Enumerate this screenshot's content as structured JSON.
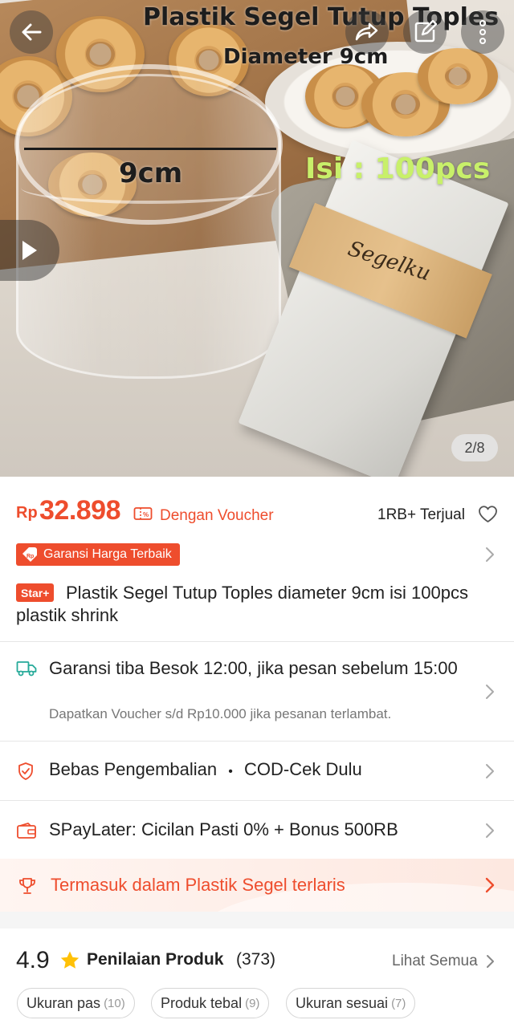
{
  "hero": {
    "caption_title": "Plastik Segel Tutup Toples",
    "caption_diameter": "Diameter 9cm",
    "caption_size": "9cm",
    "caption_isi": "Isi : 100pcs",
    "brand_band": "Segelku",
    "page_indicator": "2/8",
    "icons": [
      "back-arrow-icon",
      "share-icon",
      "edit-icon",
      "more-icon",
      "play-icon"
    ]
  },
  "price": {
    "currency": "Rp",
    "value": "32.898",
    "voucher_label": "Dengan Voucher",
    "sold": "1RB+ Terjual",
    "accent": "#ee4d2d"
  },
  "garansi_badge": "Garansi Harga Terbaik",
  "star_badge": "Star+",
  "product_title": "Plastik Segel Tutup Toples diameter 9cm isi 100pcs plastik shrink",
  "shipping": {
    "main": "Garansi tiba Besok 12:00, jika pesan sebelum 15:00",
    "sub": "Dapatkan Voucher s/d Rp10.000 jika pesanan terlambat."
  },
  "returns": {
    "label": "Bebas Pengembalian",
    "separator": "•",
    "cod": "COD-Cek Dulu"
  },
  "spaylater": "SPayLater: Cicilan Pasti 0% + Bonus 500RB",
  "bestseller": "Termasuk dalam Plastik Segel terlaris",
  "rating": {
    "score": "4.9",
    "label": "Penilaian Produk",
    "count": "(373)",
    "see_all": "Lihat Semua",
    "chips": [
      {
        "label": "Ukuran pas",
        "count": "(10)"
      },
      {
        "label": "Produk tebal",
        "count": "(9)"
      },
      {
        "label": "Ukuran sesuai",
        "count": "(7)"
      }
    ]
  }
}
